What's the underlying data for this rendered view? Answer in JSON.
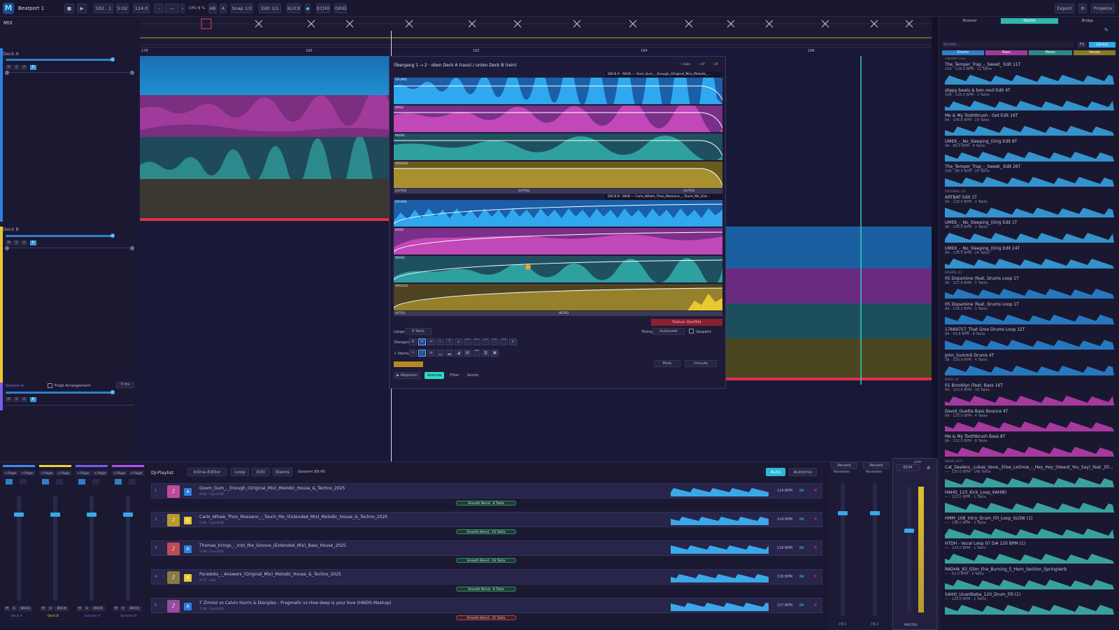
{
  "app": {
    "title": "Beatport 1"
  },
  "toolbar": {
    "position": "182 . 1",
    "time": "5:02",
    "bpm": "124.0",
    "minus_a": "–",
    "minus_b": "—",
    "cpu": "CPU 9 %",
    "ab": "AB",
    "a": "A",
    "snap": "Snap 1/1",
    "edit": "Edit 1/1",
    "klick": "KLICK",
    "echo": "ECHO",
    "grid": "GRID",
    "export": "Export",
    "projects": "Projekte"
  },
  "left": {
    "mix_label": "MIX",
    "deck_a": "Deck A",
    "deck_b": "Deck B",
    "sampler": "Sampler A",
    "follow_arrangement": "Folgt Arrangement",
    "zero_ms": "0 ms",
    "m": "M",
    "s": "S",
    "a": "A",
    "e": "E"
  },
  "transition": {
    "header": "Übergang  1 → 2   ·   oben Deck A (raus) / unten Deck B (rein)",
    "legend_gain": "Gain",
    "legend_hp": "HP",
    "legend_lp": "LP",
    "deck_a_title": "DECK A · RAUS  —  Gom_Gum_-_Enough_(Original_Mix)_Melodic_...",
    "deck_b_title": "DECK B · REIN  —  Carlo_Whale_Thon_Massano_-_Touch_Me_(Ext...",
    "bands_a": [
      "Drums",
      "Bass",
      "Music",
      "Vocals"
    ],
    "bands_b": [
      "Drums",
      "Bass",
      "Music",
      "Vocals"
    ],
    "outro1": "OUTRO",
    "outro2": "OUTRO",
    "outro3": "OUTRO",
    "intro1": "INTRO",
    "intro2": "INTRO",
    "status": "Status: Konflikt",
    "length_label": "Länge",
    "length_value": "8 Takte",
    "timing_label": "Timing",
    "timing_value": "Automatik",
    "locked_label": "Gesperrt",
    "transition_label": "Übergang",
    "stems_label": "+ Stems",
    "mute": "Mute",
    "unmute": "Unmute",
    "play": "▶ Abspielen",
    "tab_volume": "Volume",
    "tab_filter": "Filter",
    "tab_sends": "Sends"
  },
  "playlist": {
    "title": "DJ-Playlist",
    "mode": "Inline-Editor",
    "loop": "Loop",
    "edit": "Edit",
    "stems": "Stems",
    "total": "Gesamt 68:45",
    "auto": "Auto",
    "automix": "Automix",
    "rows": [
      {
        "n": "1",
        "title": "Goom_Gum_-_Enough_(Original_Mix)_Melodic_House_&_Techno_2025",
        "sub": "4:24 · Cue 0:02",
        "bpm": "124 BPM",
        "key": "8A",
        "deck": "A",
        "color": "#c04a9a",
        "blend": "Smooth Blend · 8 Takte"
      },
      {
        "n": "2",
        "title": "Carlo_Whale_Thon_Massano_-_Touch_Me_(Extended_Mix)_Melodic_House_&_Techno_2025",
        "sub": "5:56 · Cue 0:00",
        "bpm": "124 BPM",
        "key": "8A",
        "deck": "B",
        "color": "#b89a30",
        "blend": "Smooth Blend · 16 Takte"
      },
      {
        "n": "3",
        "title": "Thomas_Krings_-_Into_the_Groove_(Extended_Mix)_Bass_House_2025",
        "sub": "5:38 · Cue 0:02",
        "bpm": "126 BPM",
        "key": "8A",
        "deck": "A",
        "color": "#c04a5a",
        "blend": "Smooth Blend · 16 Takte"
      },
      {
        "n": "4",
        "title": "Paradoks_-_Answers_(Original_Mix)_Melodic_House_&_Techno_2025",
        "sub": "4:27 · Cue",
        "bpm": "126 BPM",
        "key": "8A",
        "deck": "B",
        "color": "#8a7a40",
        "blend": "Smooth Blend · 8 Takte"
      },
      {
        "n": "5",
        "title": "T Zimmz vs Calvin Harris & Disciples - Pragmatic vs How deep is your love (HINDS Mashup)",
        "sub": "7:29 · Cue 0:00",
        "bpm": "127 BPM",
        "key": "8A",
        "deck": "A",
        "color": "#9a4aa0",
        "blend": "Smooth Blend · 32 Takte"
      }
    ]
  },
  "mixer": {
    "channels": [
      {
        "name": "Deck A",
        "color": "#3a8ef0"
      },
      {
        "name": "Deck B",
        "color": "#f0d030"
      },
      {
        "name": "Sampler A",
        "color": "#7a5af0"
      },
      {
        "name": "Sampler B",
        "color": "#b050f0"
      }
    ],
    "plugin": "+ Plugin",
    "duck": "DUCK",
    "fx1": "Reverb",
    "fx2": "Reverb",
    "fx1_label": "FX 1",
    "fx2_label": "FX 2",
    "parameter": "Parameter",
    "master_preset": "EDM",
    "master_label": "MASTER",
    "limit": "Limit"
  },
  "library": {
    "tabs": [
      "Browser",
      "Palette",
      "Bridge"
    ],
    "active_tab": "Palette",
    "search_placeholder": "Suchen ...",
    "fx": "FX",
    "library_btn": "Library",
    "cats": [
      "Drums",
      "Bass",
      "Music",
      "Vocals"
    ],
    "groups": {
      "g1": "Library (10)",
      "g2": "Original (3)",
      "g3": "Drums (4)",
      "g4": "Bass (3)",
      "g5": "Music (67)"
    },
    "items": [
      {
        "t": "The_Temper_Trap_-_Sweet_ Edit 11T",
        "m": "10A · 128.0 BPM · 11 Takte",
        "c": "#3aa8e8"
      },
      {
        "t": "slippy beats & ben revil Edit 4T",
        "m": "10A · 128.0 BPM · 2 Takte",
        "c": "#3aa8e8"
      },
      {
        "t": "Me & My Toothbrush - Get Edit 16T",
        "m": "8A · 106.8 BPM · 14 Takte",
        "c": "#3aa8e8"
      },
      {
        "t": "UMEK_-_No_Sleeping_(Orig Edit 8T",
        "m": "9A · 68.0 BPM · 4 Takte",
        "c": "#3aa8e8"
      },
      {
        "t": "The_Temper_Trap_-_Sweet_ Edit 26T",
        "m": "10A · 86.5 BPM · 26 Takte",
        "c": "#3aa8e8"
      },
      {
        "t": "ARTBAT Edit 1T",
        "m": "5A · 128.0 BPM · 1 Takte",
        "c": "#3aa8e8"
      },
      {
        "t": "UMEK_-_No_Sleeping_(Orig Edit 1T",
        "m": "9A · 136.0 BPM · 1 Takte",
        "c": "#3aa8e8"
      },
      {
        "t": "UMEK_-_No_Sleeping_(Orig Edit 24T",
        "m": "9A · 136.0 BPM · 24 Takte",
        "c": "#3aa8e8"
      },
      {
        "t": "05 Dopamine (feat. Drums Loop 1T",
        "m": "9A · 117.8 BPM · 1 Takte",
        "c": "#2a88d8"
      },
      {
        "t": "05 Dopamine (feat. Drums Loop 1T",
        "m": "9A · 118.2 BPM · 1 Takte",
        "c": "#2a88d8"
      },
      {
        "t": "17669757_That Groo Drums Loop 12T",
        "m": "8A · 94.8 BPM · 9 Takte",
        "c": "#2a88d8"
      },
      {
        "t": "John_Summit Drums 4T",
        "m": "3B · 128.0 BPM · 4 Takte",
        "c": "#2a88d8"
      },
      {
        "t": "01 Brooklyn (feat. Bass 16T",
        "m": "9A · 123.0 BPM · 16 Takte",
        "c": "#c040b0"
      },
      {
        "t": "David_Guetta Bass Bounce 4T",
        "m": "6A · 120.0 BPM · 4 Takte",
        "c": "#c040b0"
      },
      {
        "t": "Me & My Toothbrush Bass 8T",
        "m": "8A · 122.0 BPM · 8 Takte",
        "c": "#c040b0"
      },
      {
        "t": "Cat_Dealers_,Lukas_Vane,_Elise_LeGrow_-_Hey_Hey_(Heard_You_Say)_feat._Eli...",
        "m": "— · 120.0 BPM · 146 Takte",
        "c": "#40b8b0"
      },
      {
        "t": "HAHD_123_Kick_Loop_KAHIKI",
        "m": "— · 122.0 BPM · 1 Takte",
        "c": "#40b8b0"
      },
      {
        "t": "HMM_108_Intro_Drum_Fill_Loop_SLOW (1)",
        "m": "— · 108.0 BPM · 2 Takte",
        "c": "#40b8b0"
      },
      {
        "t": "HTDH - Vocal Loop 07 D# 120 BPM (1)",
        "m": "— · 124.0 BPM · 1 Takte",
        "c": "#40b8b0"
      },
      {
        "t": "RADHA_83_Glim_Fire_Burning_5_Horn_Section_SpringVerb",
        "m": "— · 82.0 BPM · 3 Takte",
        "c": "#40b8b0"
      },
      {
        "t": "SAHO_Unanlbeba_120_Drum_Fill (1)",
        "m": "— · 120.0 BPM · 1 Takte",
        "c": "#40b8b0"
      }
    ]
  },
  "ruler": {
    "m1": "178",
    "m2": "180",
    "m3": "182",
    "m4": "184",
    "m5": "186",
    "m6": "188"
  },
  "colors": {
    "drums": "#2f9fe0",
    "bass": "#c34ab8",
    "music": "#2f9a9a",
    "vocals": "#b8a030",
    "accent": "#2fd8c8"
  }
}
